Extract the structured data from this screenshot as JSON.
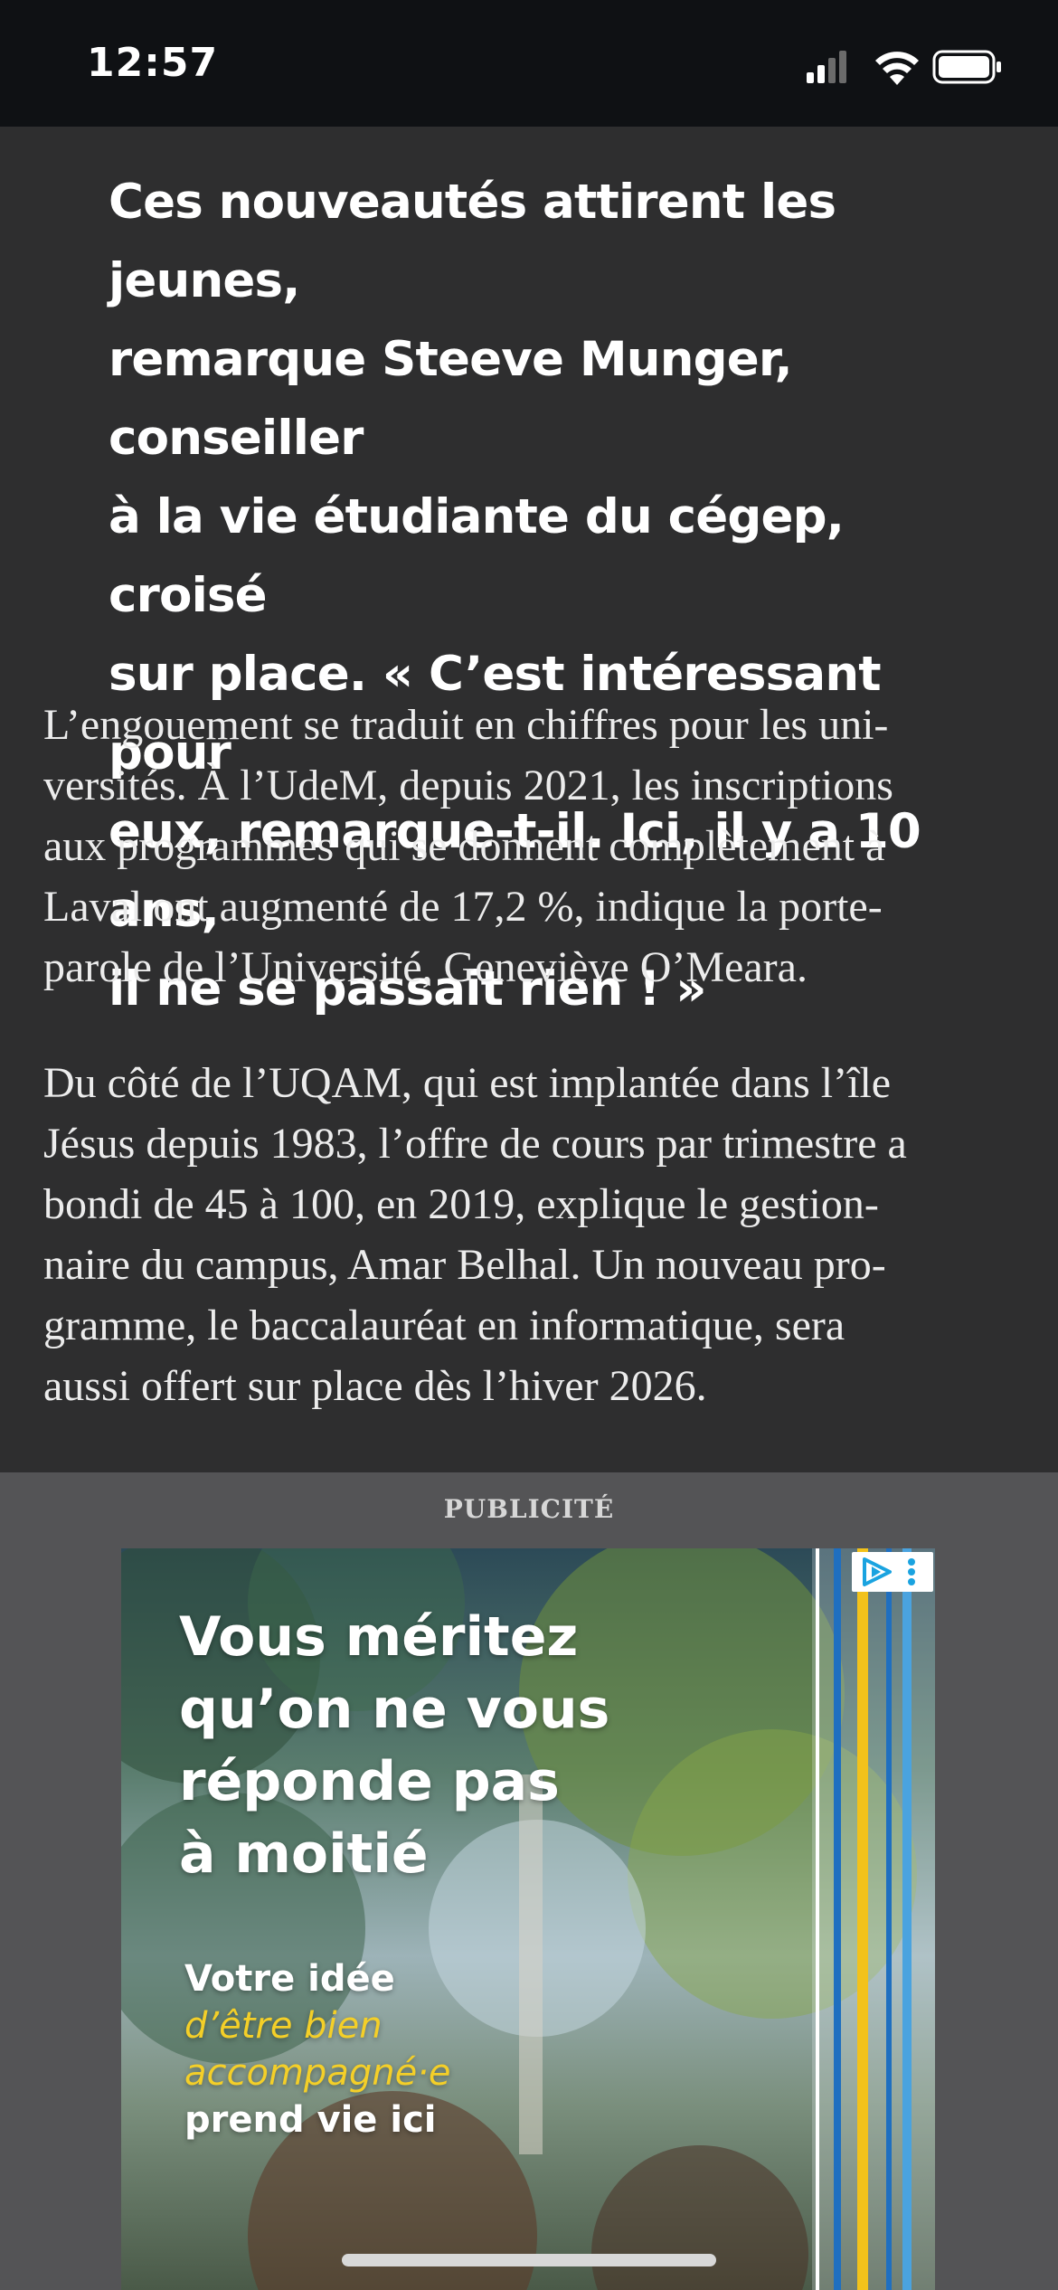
{
  "status_bar": {
    "time": "12:57",
    "icons": [
      "cellular-signal-icon",
      "wifi-icon",
      "battery-icon"
    ]
  },
  "article": {
    "pull_quote_lines": [
      "Ces nouveautés attirent les jeunes,",
      "remarque Steeve Munger, conseiller",
      "à la vie étudiante du cégep, croisé",
      "sur place. « C’est intéressant pour",
      "eux, remarque-t-il. Ici, il y a 10 ans,",
      "il ne se passait rien ! »"
    ],
    "paragraph_1_lines": [
      "L’engouement se traduit en chiffres pour les uni-",
      "versités. À l’UdeM, depuis 2021, les inscriptions",
      "aux programmes qui se donnent complètement à",
      "Laval ont augmenté de 17,2 %, indique la porte-",
      "parole de l’Université, Geneviève O’Meara."
    ],
    "paragraph_2_lines": [
      "Du côté de l’UQAM, qui est implantée dans l’île",
      "Jésus depuis 1983, l’offre de cours par trimestre a",
      "bondi de 45 à 100, en 2019, explique le gestion-",
      "naire du campus, Amar Belhal. Un nouveau pro-",
      "gramme, le baccalauréat en informatique, sera",
      "aussi offert sur place dès l’hiver 2026."
    ]
  },
  "ad": {
    "label": "PUBLICITÉ",
    "headline_lines": [
      "Vous méritez",
      "qu’on ne vous",
      "réponde pas",
      "à moitié"
    ],
    "sub_line_1": "Votre idée",
    "highlight_line_1": "d’être bien",
    "highlight_line_2": "accompagné·e",
    "sub_line_2": "prend vie ici",
    "adchoices_icon": "adchoices-icon",
    "colors": {
      "highlight": "#f4cf28",
      "stripe_blue": "#1f6fc0",
      "stripe_yellow": "#f2c21b"
    }
  },
  "colors": {
    "status_bar_bg": "#0f1114",
    "article_bg": "#2e2e2f",
    "ad_area_bg": "#545456",
    "text": "#ececec"
  }
}
